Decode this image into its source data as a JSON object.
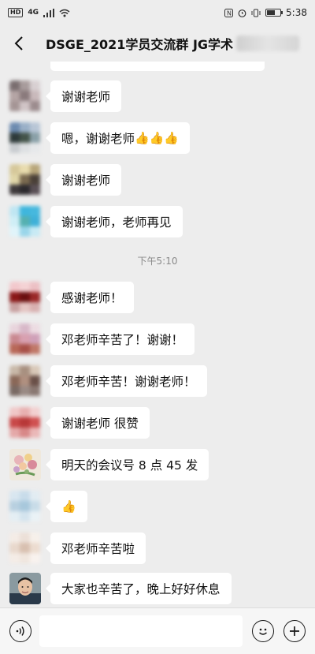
{
  "status_bar": {
    "left_badge": "HD",
    "network": "4G",
    "time": "5:38"
  },
  "header": {
    "title": "DSGE_2021学员交流群 JG学术"
  },
  "chat": {
    "time_divider": "下午5:10",
    "messages": [
      {
        "text": "谢谢老师"
      },
      {
        "text": "嗯，谢谢老师",
        "thumbs": "👍👍👍"
      },
      {
        "text": "谢谢老师"
      },
      {
        "text": "谢谢老师，老师再见"
      },
      {
        "text": "感谢老师！"
      },
      {
        "text": "邓老师辛苦了！谢谢！"
      },
      {
        "text": "邓老师辛苦！谢谢老师！"
      },
      {
        "text": "谢谢老师 很赞"
      },
      {
        "text": "明天的会议号 8 点 45 发"
      },
      {
        "text": "",
        "thumbs": "👍"
      },
      {
        "text": "邓老师辛苦啦"
      },
      {
        "text": "大家也辛苦了，晚上好好休息"
      }
    ]
  },
  "input_bar": {
    "voice_icon": "voice-icon",
    "emoji_icon": "emoji-icon",
    "plus_icon": "plus-icon"
  }
}
